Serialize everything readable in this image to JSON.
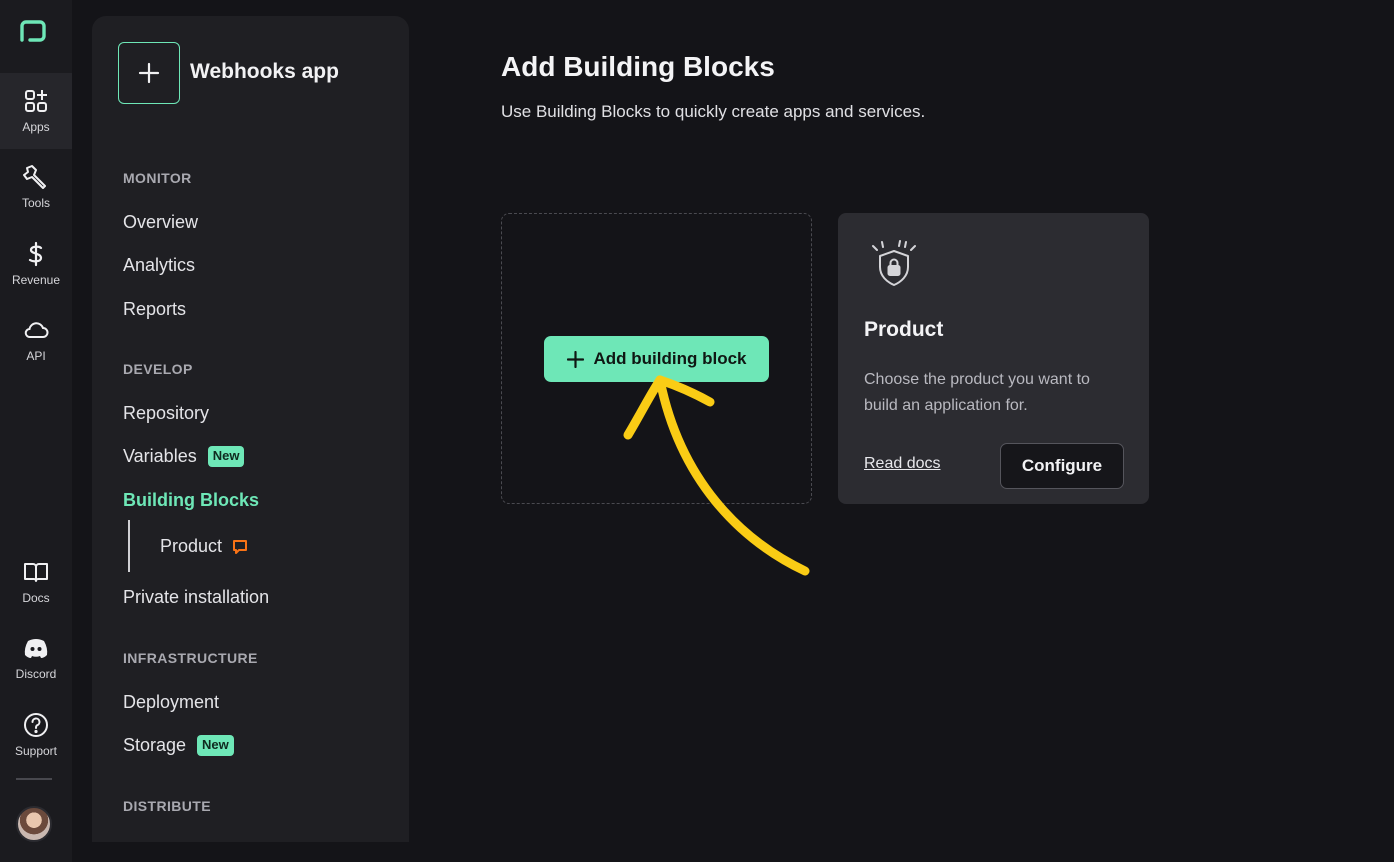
{
  "rail": {
    "items": [
      {
        "label": "Apps",
        "icon": "apps-icon"
      },
      {
        "label": "Tools",
        "icon": "wrench-icon"
      },
      {
        "label": "Revenue",
        "icon": "dollar-icon"
      },
      {
        "label": "API",
        "icon": "cloud-icon"
      },
      {
        "label": "Docs",
        "icon": "book-icon"
      },
      {
        "label": "Discord",
        "icon": "discord-icon"
      },
      {
        "label": "Support",
        "icon": "help-icon"
      }
    ]
  },
  "sidebar": {
    "app_name": "Webhooks app",
    "sections": {
      "monitor": "MONITOR",
      "develop": "DEVELOP",
      "infrastructure": "INFRASTRUCTURE",
      "distribute": "DISTRIBUTE"
    },
    "items": {
      "overview": "Overview",
      "analytics": "Analytics",
      "reports": "Reports",
      "repository": "Repository",
      "variables": "Variables",
      "building_blocks": "Building Blocks",
      "product": "Product",
      "private_installation": "Private installation",
      "deployment": "Deployment",
      "storage": "Storage"
    },
    "badge_new": "New"
  },
  "main": {
    "title": "Add Building Blocks",
    "subtitle": "Use Building Blocks to quickly create apps and services.",
    "add_button": "Add building block",
    "card": {
      "title": "Product",
      "description": "Choose the product you want to build an application for.",
      "link": "Read docs",
      "button": "Configure"
    }
  },
  "colors": {
    "accent": "#6ee7b7",
    "background": "#141418",
    "annotation": "#facc15",
    "comment": "#f97316"
  }
}
